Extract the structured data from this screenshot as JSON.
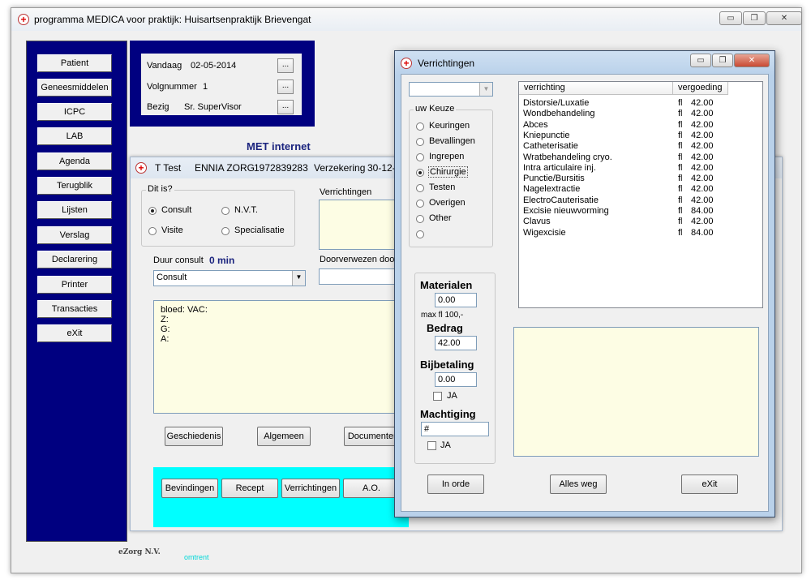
{
  "main_window": {
    "title": "programma MEDICA voor praktijk: Huisartsenpraktijk Brievengat",
    "caption_buttons": {
      "minimize": "▭",
      "restore": "❐",
      "close": "✕"
    }
  },
  "nav": {
    "items": [
      "Patient",
      "Geneesmiddelen",
      "ICPC",
      "LAB",
      "Agenda",
      "Terugblik",
      "Lijsten",
      "Verslag",
      "Declarering",
      "Printer",
      "Transacties",
      "eXit"
    ]
  },
  "info": {
    "vandaag_label": "Vandaag",
    "vandaag_value": "02-05-2014",
    "volgnummer_label": "Volgnummer",
    "volgnummer_value": "1",
    "bezig_label": "Bezig",
    "bezig_value": "Sr. SuperVisor",
    "ellipsis": "..."
  },
  "met_internet": "MET internet",
  "ttest": {
    "title": "T Test",
    "insurer": "ENNIA ZORG",
    "number": "1972839283",
    "verzekering_label": "Verzekering",
    "verzekering_value": "30-12-",
    "dit_is_label": "Dit is?",
    "options": {
      "consult": "Consult",
      "nvt": "N.V.T.",
      "visite": "Visite",
      "specialisatie": "Specialisatie"
    },
    "verrichtingen_label": "Verrichtingen",
    "duur_label": "Duur consult",
    "duur_value": "0 min",
    "doorverwezen_label": "Doorverwezen door",
    "consult_select": "Consult",
    "notes": [
      "bloed:  VAC:",
      "Z:",
      "G:",
      "A:"
    ],
    "buttons": {
      "geschiedenis": "Geschiedenis",
      "algemeen": "Algemeen",
      "documenten": "Documenten"
    },
    "bottom_buttons": {
      "bevindingen": "Bevindingen",
      "recept": "Recept",
      "verrichtingen": "Verrichtingen",
      "ao": "A.O."
    }
  },
  "footer": {
    "company": "eZorg N.V.",
    "omtrent": "omtrent"
  },
  "verrichtingen_dialog": {
    "title": "Verrichtingen",
    "uw_keuze_label": "uw Keuze",
    "choices": [
      "Keuringen",
      "Bevallingen",
      "Ingrepen",
      "Chirurgie",
      "Testen",
      "Overigen",
      "Other",
      ""
    ],
    "selected_choice": "Chirurgie",
    "materialen_label": "Materialen",
    "materialen_value": "0.00",
    "max_label": "max fl 100,-",
    "bedrag_label": "Bedrag",
    "bedrag_value": "42.00",
    "bijbetaling_label": "Bijbetaling",
    "bijbetaling_value": "0.00",
    "ja_label": "JA",
    "machtiging_label": "Machtiging",
    "machtiging_value": "#",
    "list_headers": {
      "verrichting": "verrichting",
      "vergoeding": "vergoeding"
    },
    "rows": [
      {
        "name": "Distorsie/Luxatie",
        "currency": "fl",
        "amount": "42.00"
      },
      {
        "name": "Wondbehandeling",
        "currency": "fl",
        "amount": "42.00"
      },
      {
        "name": "Abces",
        "currency": "fl",
        "amount": "42.00"
      },
      {
        "name": "Kniepunctie",
        "currency": "fl",
        "amount": "42.00"
      },
      {
        "name": "Catheterisatie",
        "currency": "fl",
        "amount": "42.00"
      },
      {
        "name": "Wratbehandeling cryo.",
        "currency": "fl",
        "amount": "42.00"
      },
      {
        "name": "Intra articulaire inj.",
        "currency": "fl",
        "amount": "42.00"
      },
      {
        "name": "Punctie/Bursitis",
        "currency": "fl",
        "amount": "42.00"
      },
      {
        "name": "Nagelextractie",
        "currency": "fl",
        "amount": "42.00"
      },
      {
        "name": "ElectroCauterisatie",
        "currency": "fl",
        "amount": "42.00"
      },
      {
        "name": "Excisie nieuwvorming",
        "currency": "fl",
        "amount": "84.00"
      },
      {
        "name": "Clavus",
        "currency": "fl",
        "amount": "42.00"
      },
      {
        "name": "Wigexcisie",
        "currency": "fl",
        "amount": "84.00"
      }
    ],
    "buttons": {
      "in_orde": "In orde",
      "alles_weg": "Alles weg",
      "exit": "eXit"
    }
  }
}
